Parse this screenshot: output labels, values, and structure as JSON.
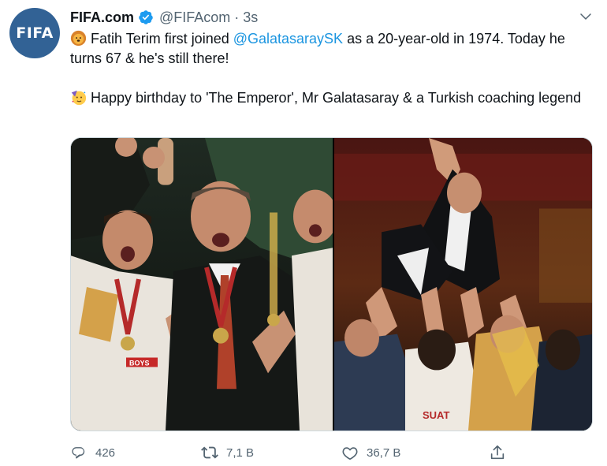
{
  "tweet": {
    "avatar_text": "FIFA",
    "display_name": "FIFA.com",
    "handle": "@FIFAcom",
    "separator": "·",
    "time": "3s",
    "text_1_emoji": "lion-face-emoji",
    "text_1_part_1": "Fatih Terim first joined ",
    "mention": "@GalatasaraySK",
    "text_1_part_2": " as a 20-year-old in 1974. Today he turns 67 & he's still there!",
    "text_2_emoji": "partying-face-emoji",
    "text_2": "Happy birthday to 'The Emperor', Mr Galatasaray & a Turkish coaching legend",
    "photo_left_jersey_text": "BOYS",
    "photo_right_jersey_text": "SUAT"
  },
  "actions": {
    "reply_count": "426",
    "retweet_count": "7,1 B",
    "like_count": "36,7 B"
  },
  "icons": {
    "reply": "speech-bubble-icon",
    "retweet": "retweet-arrows-icon",
    "like": "heart-icon",
    "share": "share-upload-icon",
    "more": "chevron-down-icon",
    "verified": "verified-badge-icon"
  },
  "colors": {
    "link": "#1b95e0",
    "verified": "#1d9bf0",
    "secondary_text": "#536471",
    "avatar_bg": "#326295"
  }
}
